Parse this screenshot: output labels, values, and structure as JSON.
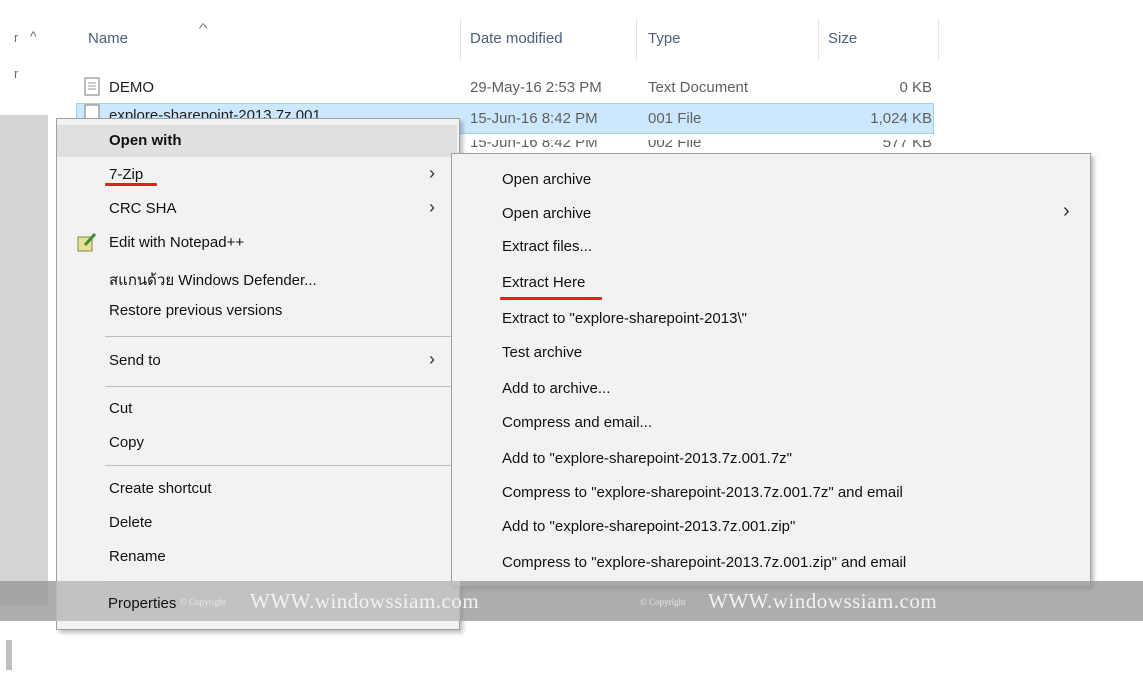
{
  "columns": {
    "name": "Name",
    "date_modified": "Date modified",
    "type": "Type",
    "size": "Size"
  },
  "files": [
    {
      "name": "DEMO",
      "date": "29-May-16 2:53 PM",
      "type": "Text Document",
      "size": "0 KB"
    },
    {
      "name": "explore-sharepoint-2013.7z.001",
      "date": "15-Jun-16 8:42 PM",
      "type": "001 File",
      "size": "1,024 KB"
    },
    {
      "name": "",
      "date": "15-Jun-16 8:42 PM",
      "type": "002 File",
      "size": "577 KB"
    }
  ],
  "context_menu": {
    "open_with": "Open with",
    "seven_zip": "7-Zip",
    "crc_sha": "CRC SHA",
    "edit_notepad": "Edit with Notepad++",
    "scan_defender": "สแกนด้วย Windows Defender...",
    "restore": "Restore previous versions",
    "send_to": "Send to",
    "cut": "Cut",
    "copy": "Copy",
    "create_shortcut": "Create shortcut",
    "delete": "Delete",
    "rename": "Rename",
    "properties": "Properties"
  },
  "submenu": {
    "open_archive": "Open archive",
    "open_archive_2": "Open archive",
    "extract_files": "Extract files...",
    "extract_here": "Extract Here",
    "extract_to": "Extract to \"explore-sharepoint-2013\\\"",
    "test_archive": "Test archive",
    "add_to_archive": "Add to archive...",
    "compress_email": "Compress and email...",
    "add_to_7z": "Add to \"explore-sharepoint-2013.7z.001.7z\"",
    "compress_7z_email": "Compress to \"explore-sharepoint-2013.7z.001.7z\" and email",
    "add_to_zip": "Add to \"explore-sharepoint-2013.7z.001.zip\"",
    "compress_zip_email": "Compress to \"explore-sharepoint-2013.7z.001.zip\" and email"
  },
  "watermark": {
    "copyright_small": "© Copyright",
    "site": "WWW.windowssiam.com"
  },
  "icons": {
    "submenu_arrow": "›",
    "sort_arrow": "^",
    "nav_up": "^"
  },
  "colors": {
    "selection": "#cce8ff",
    "underline": "#e21f1f",
    "header_text": "#4c607a"
  }
}
